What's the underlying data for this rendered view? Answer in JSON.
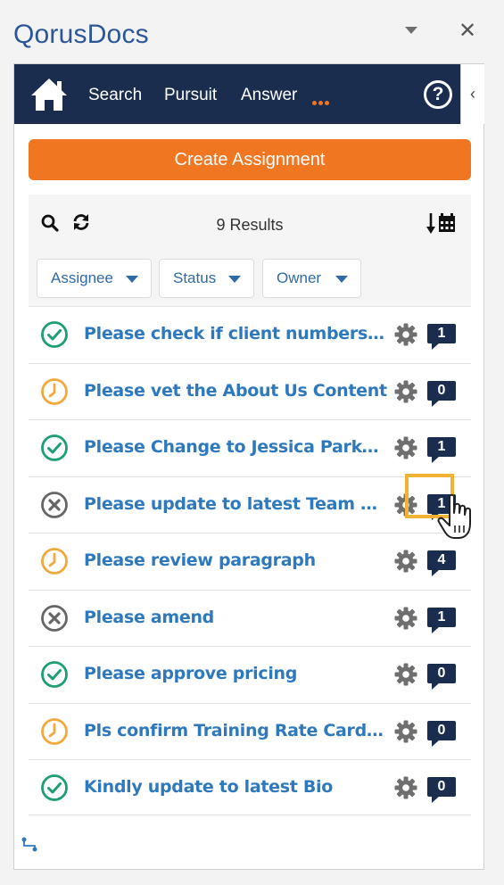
{
  "pane": {
    "title": "QorusDocs"
  },
  "nav": {
    "links": [
      "Search",
      "Pursuit",
      "Answer"
    ],
    "help_label": "?",
    "collapse_label": "‹"
  },
  "actions": {
    "create_label": "Create Assignment"
  },
  "toolbar": {
    "results_label": "9 Results",
    "filters": [
      "Assignee",
      "Status",
      "Owner"
    ]
  },
  "colors": {
    "navbar": "#1b2d4f",
    "accent": "#f07622",
    "link": "#2e79be",
    "status_done": "#1e9e77",
    "status_pending": "#f2a93b",
    "status_cancelled": "#666666",
    "highlight": "#f2b233"
  },
  "assignments": [
    {
      "status": "done",
      "icon": "check-circle-icon",
      "title": "Please check if client numbers are correct",
      "comments": "1"
    },
    {
      "status": "pending",
      "icon": "clock-icon",
      "title": "Please vet the About Us Content",
      "comments": "0"
    },
    {
      "status": "done",
      "icon": "check-circle-icon",
      "title": "Please Change to Jessica Parker Bio",
      "comments": "1"
    },
    {
      "status": "cancelled",
      "icon": "x-circle-icon",
      "title": "Please update to latest Team description",
      "comments": "1"
    },
    {
      "status": "pending",
      "icon": "clock-icon",
      "title": "Please review paragraph",
      "comments": "4"
    },
    {
      "status": "cancelled",
      "icon": "x-circle-icon",
      "title": "Please amend",
      "comments": "1"
    },
    {
      "status": "done",
      "icon": "check-circle-icon",
      "title": "Please approve pricing",
      "comments": "0"
    },
    {
      "status": "pending",
      "icon": "clock-icon",
      "title": "Pls confirm Training Rate Card rates",
      "comments": "0"
    },
    {
      "status": "done",
      "icon": "check-circle-icon",
      "title": "Kindly update to latest Bio",
      "comments": "0"
    }
  ]
}
